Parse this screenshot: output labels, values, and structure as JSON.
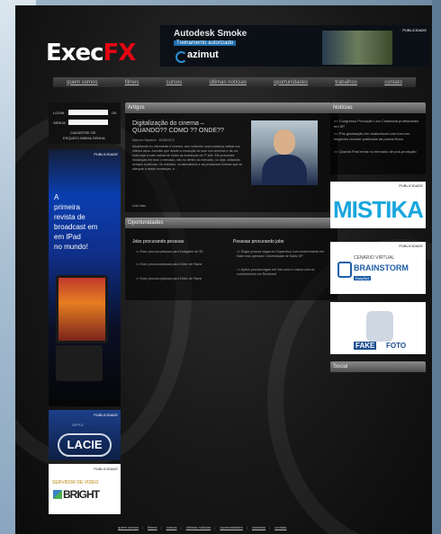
{
  "header": {
    "logo_main": "Exec",
    "logo_accent": "FX",
    "banner_brand": "Autodesk Smoke",
    "banner_tagline": "Treinamento autorizado",
    "banner_partner": "azimut",
    "banner_pub": "PUBLICIDADE"
  },
  "nav": {
    "items": [
      "quem somos",
      "filmes",
      "cursos",
      "últimas notícias",
      "oportunidades",
      "trabalhos",
      "contato"
    ]
  },
  "login": {
    "login_label": "LOGIN",
    "senha_label": "SENHA",
    "ok_label": "OK",
    "register": "CADASTRE-SE",
    "forgot": "ESQUECI MINHA SENHA"
  },
  "left_ads": {
    "ad1_pub": "PUBLICIDADE",
    "ad1_text": "A\nprimeira\nrevista de\nbroadcast em\nem IPad\nno mundo!",
    "ad2_pub": "PUBLICIDADE",
    "ad2_small": "APPLE",
    "ad2_brand": "LACIE",
    "ad3_pub": "PUBLICIDADE",
    "ad3_tag": "SERVIDOR DE VÍDEO",
    "ad3_brand": "BRIGHT"
  },
  "article": {
    "section": "Artigos",
    "title": "Digitalização do cinema – QUANDO?? COMO ?? ONDE??",
    "author": "Marcelo Siqueira",
    "date": "26/08/2012",
    "body": "Atualmente eu, felizmente é cinema, vem sofrendo uma mudança radical nos últimos anos. Acredito que desde a revolução do som nos cinemas e da cor, essa seja a mais radical de todas as mudanças da 7ª arte. Ela provocará mudanças em todo o mercado, não só dentro do mercado, ou seja, utilizando sempre a película. Os estúdios, os laboratórios e as produtoras tiveram que se adequar a essas mudanças, e...",
    "more": "Leia mais"
  },
  "opportunities": {
    "section": "Oportunidades",
    "col1_title": "Jobs procurando pessoas",
    "col1_items": [
      ">> Exec procura pessoas para Estagiário de 3D",
      ">> Exec procura pessoas para Editor de Flame",
      ">> Exec procura pessoas para Editor de Flame"
    ],
    "col2_title": "Pessoas procurando jobs",
    "col2_items": [
      ">> Edgar procura vagas em Supervisor com conhecimento em Nuke mas operador. Universidade de Santo SP",
      ">> Ayrton procura vagas em 3ds como e coloca com os conhecimento em Rendered"
    ]
  },
  "right": {
    "section": "Notícias",
    "items": [
      ">> Congresso Produção Livo Cidadania profissionais em SP",
      ">> Pós graduação em audiovisual com foco em negócios recente publicada da parcia Nova",
      ">> Quanta Post entra no mercado de pós-produção"
    ],
    "ad_mistika_pub": "PUBLICIDADE",
    "ad_mistika": "MISTIKA",
    "ad_brain_pub": "PUBLICIDADE",
    "ad_brain_t1": "CENÁRIO VIRTUAL",
    "ad_brain_t2": "BRAINSTORM",
    "ad_brain_t3": "EasySet",
    "ad_fake1": "FAKE",
    "ad_fake2": "FOTO",
    "section2": "Social"
  },
  "footer": {
    "links": [
      "quem somos",
      "filmes",
      "cursos",
      "últimas notícias",
      "oportunidades",
      "contatos",
      "contato"
    ]
  }
}
